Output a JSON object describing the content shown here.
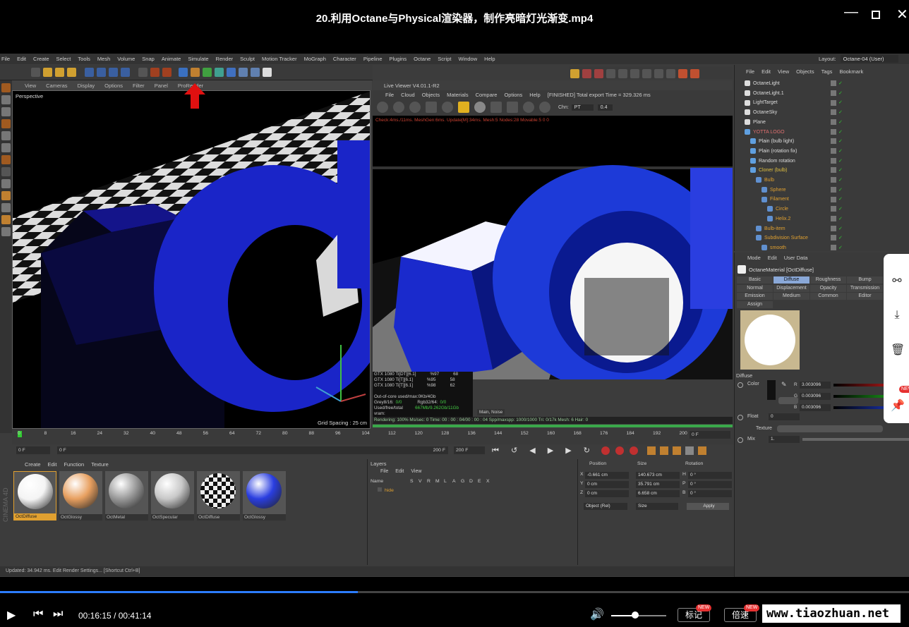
{
  "player": {
    "title": "20.利用Octane与Physical渲染器，制作亮暗灯光渐变.mp4",
    "current_time": "00:16:15",
    "separator": "/",
    "total_time": "00:41:14",
    "progress": 0.394,
    "volume": 0.44,
    "mark_label": "标记",
    "speed_label": "倍速",
    "new_badge": "NEW",
    "watermark": "www.tiaozhuan.net"
  },
  "c4d": {
    "menu": [
      "File",
      "Edit",
      "Create",
      "Select",
      "Tools",
      "Mesh",
      "Volume",
      "Snap",
      "Animate",
      "Simulate",
      "Render",
      "Sculpt",
      "Motion Tracker",
      "MoGraph",
      "Character",
      "Pipeline",
      "Plugins",
      "Octane",
      "Script",
      "Window",
      "Help"
    ],
    "layout_label": "Layout:",
    "layout_value": "Octane-04 (User)",
    "viewport_menu": [
      "View",
      "Cameras",
      "Display",
      "Options",
      "Filter",
      "Panel",
      "ProRender"
    ],
    "viewport_label": "Perspective",
    "grid_spacing": "Grid Spacing : 25 cm",
    "live_viewer_title": "Live Viewer V4.01.1-R2",
    "live_viewer_menu": [
      "File",
      "Cloud",
      "Objects",
      "Materials",
      "Compare",
      "Options",
      "Help"
    ],
    "live_viewer_status": "[FINISHED] Total export Time = 329.326 ms",
    "chn_label": "Chn:",
    "chn_value": "PT",
    "chn_num": "0.4",
    "lv_stats": "Check:4ms./11ms. MeshGen:6ms. Update[M]:34ms. Mesh:5 Nodes:28 Movable:5  0 0",
    "gpus": [
      {
        "name": "GTX 1080 Ti[DT][6.1]",
        "pct": "%97",
        "temp": "68"
      },
      {
        "name": "GTX 1080 Ti[T][6.1]",
        "pct": "%95",
        "temp": "58"
      },
      {
        "name": "GTX 1080 Ti[T][6.1]",
        "pct": "%98",
        "temp": "62"
      }
    ],
    "out_of_core": "Out-of-core used/max:0Kb/4Gb",
    "grey_label": "Grey8/16:",
    "grey_val": "0/0",
    "rgb_label": "Rgb32/64:",
    "rgb_val": "0/0",
    "vram_label": "Used/free/total vram:",
    "vram_val": "667Mb/9.262Gb/11Gb",
    "main_btn": "Main",
    "noise_btn": "Noise",
    "render_info": "Rendering: 100%  Ms/sec: 0    Time: 00 : 00 : 04/00 : 00 : 04   Spp/maxspp: 1000/1000    Tri: 0/17k     Mesh: 6  Hair: 0",
    "timeline_ticks": [
      "0",
      "8",
      "16",
      "24",
      "32",
      "40",
      "48",
      "56",
      "64",
      "72",
      "80",
      "88",
      "96",
      "104",
      "112",
      "120",
      "128",
      "136",
      "144",
      "152",
      "160",
      "168",
      "176",
      "184",
      "192",
      "200"
    ],
    "timeline_end": "0 F",
    "start_frame": "0 F",
    "min_frame": "0 F",
    "max_frame": "200 F",
    "end_frame": "200 F",
    "mat_menu": [
      "Create",
      "Edit",
      "Function",
      "Texture"
    ],
    "materials": [
      {
        "label": "OctDiffuse",
        "color": "#f4f4f4"
      },
      {
        "label": "OctGlossy",
        "color": "#e8a060"
      },
      {
        "label": "OctMetal",
        "color": "#9a9a9a"
      },
      {
        "label": "OctSpecular",
        "color": "#c8c8c8"
      },
      {
        "label": "OctDiffuse",
        "color": "#777777"
      },
      {
        "label": "OctGlossy",
        "color": "#2a3ee0"
      }
    ],
    "layers_title": "Layers",
    "layers_menu": [
      "File",
      "Edit",
      "View"
    ],
    "layers_cols": [
      "Name",
      "S",
      "V",
      "R",
      "M",
      "L",
      "A",
      "G",
      "D",
      "E",
      "X"
    ],
    "layer_name": "hide",
    "coord_headers": [
      "Position",
      "Size",
      "Rotation"
    ],
    "coords": [
      {
        "axis": "X",
        "pos": "-0.661 cm",
        "size": "140.673 cm",
        "rlab": "H",
        "rot": "0 °"
      },
      {
        "axis": "Y",
        "pos": "0 cm",
        "size": "35.791 cm",
        "rlab": "P",
        "rot": "0 °"
      },
      {
        "axis": "Z",
        "pos": "0 cm",
        "size": "6.658 cm",
        "rlab": "B",
        "rot": "0 °"
      }
    ],
    "coord_mode": "Object (Rel)",
    "coord_size": "Size",
    "apply": "Apply",
    "status": "Updated: 34.942 ms.     Edit Render Settings... [Shortcut Ctrl+B]",
    "logo": "CINEMA 4D",
    "obj_menu": [
      "File",
      "Edit",
      "View",
      "Objects",
      "Tags",
      "Bookmark"
    ],
    "objects": [
      {
        "name": "OctaneLight",
        "indent": 0,
        "color": "#ddd"
      },
      {
        "name": "OctaneLight.1",
        "indent": 0,
        "color": "#ddd"
      },
      {
        "name": "LightTarget",
        "indent": 0,
        "color": "#ddd"
      },
      {
        "name": "OctaneSky",
        "indent": 0,
        "color": "#ddd"
      },
      {
        "name": "Plane",
        "indent": 0,
        "color": "#ddd"
      },
      {
        "name": "YOTTA LOGO",
        "indent": 0,
        "color": "#e07070"
      },
      {
        "name": "Plain (bulb light)",
        "indent": 1,
        "color": "#ddd"
      },
      {
        "name": "Plain (rotation fix)",
        "indent": 1,
        "color": "#ddd"
      },
      {
        "name": "Random rotation",
        "indent": 1,
        "color": "#ddd"
      },
      {
        "name": "Cloner (bulb)",
        "indent": 1,
        "color": "#e0c040"
      },
      {
        "name": "Bulb",
        "indent": 2,
        "color": "#e0a030"
      },
      {
        "name": "Sphere",
        "indent": 3,
        "color": "#e0a030"
      },
      {
        "name": "Filament",
        "indent": 3,
        "color": "#e0a030"
      },
      {
        "name": "Circle",
        "indent": 4,
        "color": "#e0a030"
      },
      {
        "name": "Helix.2",
        "indent": 4,
        "color": "#e0a030"
      },
      {
        "name": "Bulb-item",
        "indent": 2,
        "color": "#e0a030"
      },
      {
        "name": "Subdivision Surface",
        "indent": 2,
        "color": "#e0a030"
      },
      {
        "name": "smooth",
        "indent": 3,
        "color": "#e0a030"
      }
    ],
    "attr_menu": [
      "Mode",
      "Edit",
      "User Data"
    ],
    "attr_title": "OctaneMaterial [OctDiffuse]",
    "attr_tabs": [
      "Basic",
      "Diffuse",
      "Roughness",
      "Bump",
      "Normal",
      "Displacement",
      "Opacity",
      "Transmission",
      "Emission",
      "Medium",
      "Common",
      "Editor",
      "Assign"
    ],
    "diffuse_label": "Diffuse",
    "color_label": "Color",
    "r": "3.003096",
    "g": "0.003096",
    "b": "0.003096",
    "float_label": "Float",
    "float_val": "0",
    "texture_label": "Texture",
    "mix_label": "Mix",
    "mix_val": "1."
  }
}
